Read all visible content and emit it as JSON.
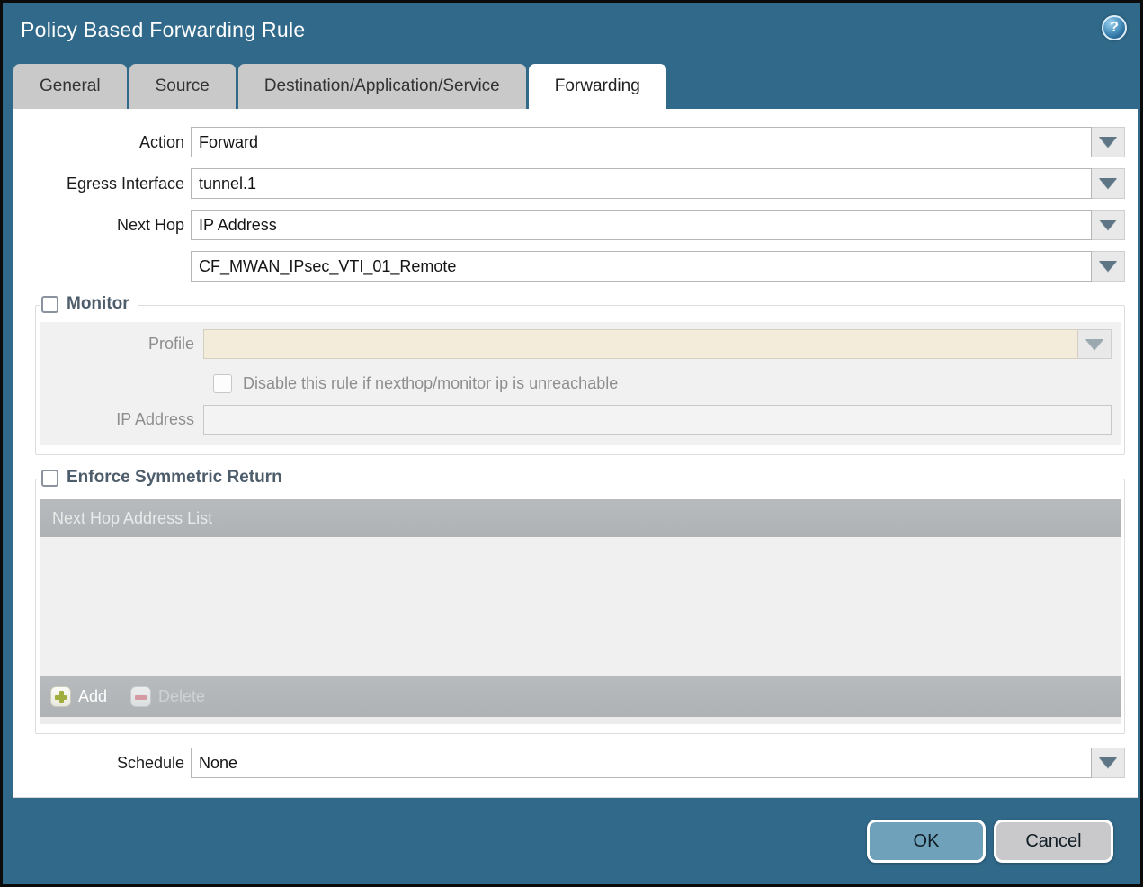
{
  "dialog": {
    "title": "Policy Based Forwarding Rule"
  },
  "icons": {
    "help_glyph": "?"
  },
  "tabs": [
    {
      "label": "General",
      "active": false
    },
    {
      "label": "Source",
      "active": false
    },
    {
      "label": "Destination/Application/Service",
      "active": false
    },
    {
      "label": "Forwarding",
      "active": true
    }
  ],
  "form": {
    "action": {
      "label": "Action",
      "value": "Forward"
    },
    "egress_interface": {
      "label": "Egress Interface",
      "value": "tunnel.1"
    },
    "next_hop": {
      "label": "Next Hop",
      "value": "IP Address"
    },
    "next_hop_address": {
      "value": "CF_MWAN_IPsec_VTI_01_Remote"
    },
    "schedule": {
      "label": "Schedule",
      "value": "None"
    }
  },
  "monitor": {
    "legend": "Monitor",
    "checked": false,
    "profile": {
      "label": "Profile",
      "value": ""
    },
    "disable_rule": {
      "label": "Disable this rule if nexthop/monitor ip is unreachable",
      "checked": false
    },
    "ip_address": {
      "label": "IP Address",
      "value": ""
    }
  },
  "symmetric_return": {
    "legend": "Enforce Symmetric Return",
    "checked": false,
    "table_header": "Next Hop Address List",
    "rows": [],
    "add_label": "Add",
    "delete_label": "Delete"
  },
  "footer": {
    "ok_label": "OK",
    "cancel_label": "Cancel"
  },
  "colors": {
    "accent_teal": "#31698a",
    "active_tab": "#ffffff",
    "inactive_tab": "#c9c9c9",
    "table_gray": "#b3b6b8",
    "disabled_field_cream": "#f3ecda",
    "ok_button": "#6fa2ba",
    "cancel_button": "#c9c9cb",
    "add_plus_green": "#9fae3f",
    "delete_minus_red": "#d49aa2"
  }
}
